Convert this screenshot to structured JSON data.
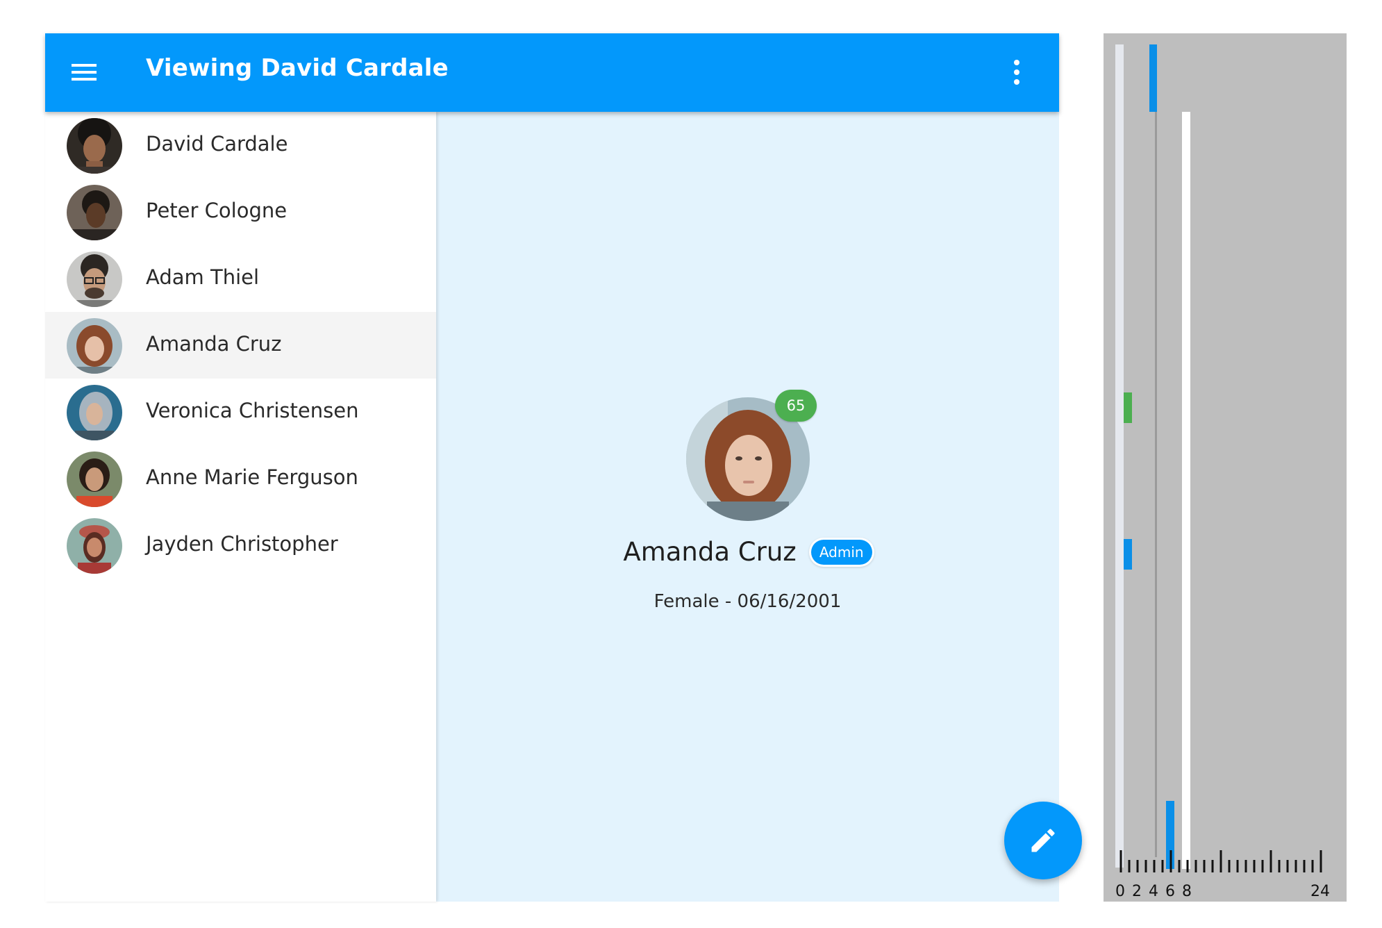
{
  "app_bar": {
    "title": "Viewing David Cardale",
    "menu_icon": "hamburger-menu-icon",
    "more_icon": "more-vert-icon",
    "color": "#0398fb"
  },
  "people": [
    {
      "name": "David Cardale"
    },
    {
      "name": "Peter Cologne"
    },
    {
      "name": "Adam Thiel"
    },
    {
      "name": "Amanda Cruz",
      "selected": true
    },
    {
      "name": "Veronica Christensen"
    },
    {
      "name": "Anne Marie Ferguson"
    },
    {
      "name": "Jayden Christopher"
    }
  ],
  "profile": {
    "name": "Amanda Cruz",
    "score": "65",
    "role": "Admin",
    "details": "Female - 06/16/2001"
  },
  "fab": {
    "icon": "edit-pencil-icon"
  },
  "scrollmap": {
    "tick_labels": [
      "0",
      "2",
      "4",
      "6",
      "8",
      "24"
    ]
  },
  "colors": {
    "accent": "#0398fb",
    "badge_green": "#4caf50",
    "detail_background": "#e3f3fd",
    "selected_row": "#f4f4f4"
  }
}
